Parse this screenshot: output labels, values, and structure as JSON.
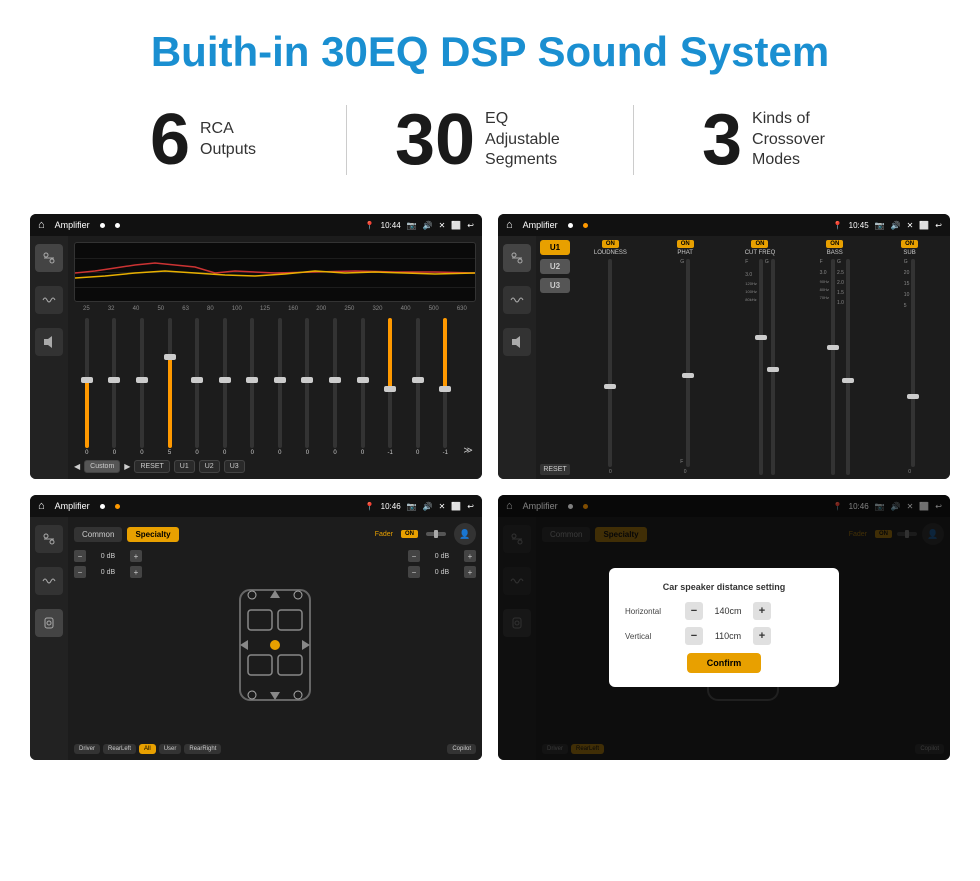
{
  "page": {
    "title": "Buith-in 30EQ DSP Sound System"
  },
  "stats": [
    {
      "number": "6",
      "label": "RCA\nOutputs"
    },
    {
      "number": "30",
      "label": "EQ Adjustable\nSegments"
    },
    {
      "number": "3",
      "label": "Kinds of\nCrossover Modes"
    }
  ],
  "screens": {
    "eq_screen": {
      "title": "Amplifier",
      "time": "10:44",
      "freq_labels": [
        "25",
        "32",
        "40",
        "50",
        "63",
        "80",
        "100",
        "125",
        "160",
        "200",
        "250",
        "320",
        "400",
        "500",
        "630"
      ],
      "slider_vals": [
        "0",
        "0",
        "0",
        "5",
        "0",
        "0",
        "0",
        "0",
        "0",
        "0",
        "0",
        "-1",
        "0",
        "-1"
      ],
      "nav_btns": [
        "Custom",
        "RESET",
        "U1",
        "U2",
        "U3"
      ]
    },
    "crossover_screen": {
      "title": "Amplifier",
      "time": "10:45",
      "u_btns": [
        "U1",
        "U2",
        "U3"
      ],
      "channels": [
        {
          "label": "LOUDNESS",
          "on": true
        },
        {
          "label": "PHAT",
          "on": true
        },
        {
          "label": "CUT FREQ",
          "on": true
        },
        {
          "label": "BASS",
          "on": true
        },
        {
          "label": "SUB",
          "on": true
        }
      ],
      "reset_btn": "RESET"
    },
    "fader_screen": {
      "title": "Amplifier",
      "time": "10:46",
      "tabs": [
        "Common",
        "Specialty"
      ],
      "fader_label": "Fader",
      "on_label": "ON",
      "db_values": [
        "0 dB",
        "0 dB",
        "0 dB",
        "0 dB"
      ],
      "bottom_btns": [
        "Driver",
        "RearLeft",
        "All",
        "User",
        "RearRight",
        "Copilot"
      ]
    },
    "distance_screen": {
      "title": "Amplifier",
      "time": "10:46",
      "tabs": [
        "Common",
        "Specialty"
      ],
      "dialog": {
        "title": "Car speaker distance setting",
        "horizontal_label": "Horizontal",
        "horizontal_val": "140cm",
        "vertical_label": "Vertical",
        "vertical_val": "110cm",
        "minus_label": "-",
        "plus_label": "+",
        "confirm_label": "Confirm"
      }
    }
  }
}
